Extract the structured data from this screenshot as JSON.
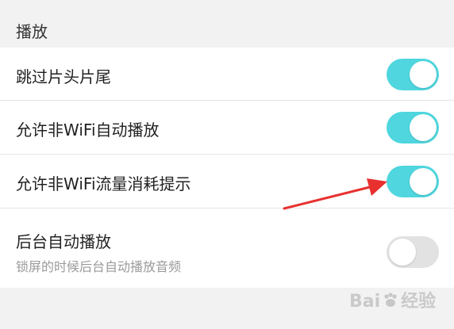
{
  "section": {
    "title": "播放"
  },
  "settings": [
    {
      "label": "跳过片头片尾",
      "on": true
    },
    {
      "label": "允许非WiFi自动播放",
      "on": true
    },
    {
      "label": "允许非WiFi流量消耗提示",
      "on": true
    },
    {
      "label": "后台自动播放",
      "sublabel": "锁屏的时候后台自动播放音频",
      "on": false
    }
  ],
  "colors": {
    "toggle_on": "#4fd6de",
    "toggle_off": "#e2e2e2",
    "arrow": "#e8312f"
  },
  "watermark": {
    "prefix": "Bai",
    "suffix": "经验"
  }
}
